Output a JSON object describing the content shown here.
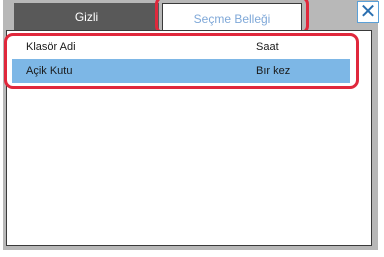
{
  "tabs": [
    {
      "label": "Gizli"
    },
    {
      "label": "Seçme Belleği"
    }
  ],
  "table": {
    "columns": [
      "Klasör Adi",
      "Saat"
    ],
    "rows": [
      {
        "name": "Açik Kutu",
        "time": "Bır kez"
      }
    ]
  },
  "colors": {
    "highlight": "#e0283c",
    "selected_row": "#7db7e6",
    "tab_dark": "#595959"
  },
  "icons": {
    "close": "close-icon"
  }
}
